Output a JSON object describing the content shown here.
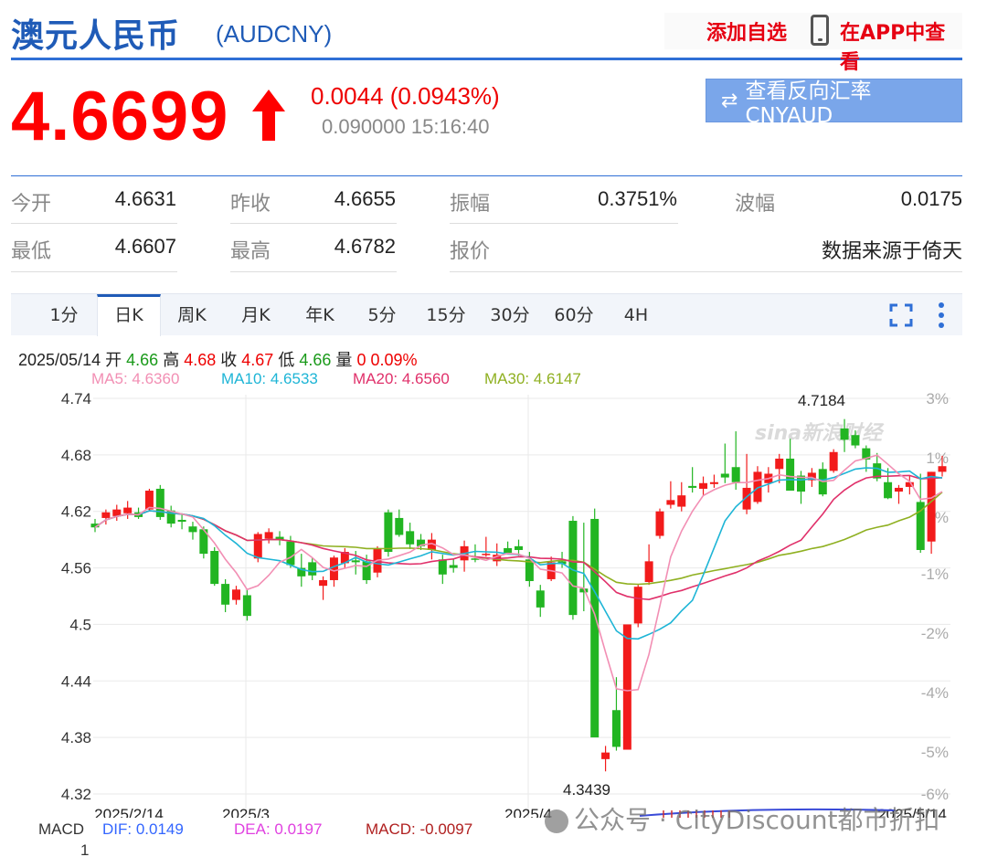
{
  "header": {
    "name": "澳元人民币",
    "code": "(AUDCNY)",
    "add_fav": "添加自选",
    "in_app": "在APP中查看"
  },
  "quote": {
    "price": "4.6699",
    "change": "0.0044 (0.0943%)",
    "sub": "0.090000 15:16:40",
    "reverse_btn": "查看反向汇率 CNYAUD",
    "up_color": "#ff0000"
  },
  "stats": {
    "open_label": "今开",
    "open": "4.6631",
    "prev_label": "昨收",
    "prev": "4.6655",
    "amp_label": "振幅",
    "amp": "0.3751%",
    "wave_label": "波幅",
    "wave": "0.0175",
    "low_label": "最低",
    "low": "4.6607",
    "high_label": "最高",
    "high": "4.6782",
    "quote_label": "报价",
    "source": "数据来源于倚天"
  },
  "tabs": [
    "1分",
    "日K",
    "周K",
    "月K",
    "年K",
    "5分",
    "15分",
    "30分",
    "60分",
    "4H"
  ],
  "active_tab": "日K",
  "ohlc": {
    "date": "2025/05/14",
    "open_label": "开",
    "open": "4.66",
    "high_label": "高",
    "high": "4.68",
    "close_label": "收",
    "close": "4.67",
    "low_label": "低",
    "low": "4.66",
    "vol_label": "量",
    "vol": "0",
    "pct": "0.09%"
  },
  "ma": {
    "ma5": "MA5: 4.6360",
    "ma10": "MA10: 4.6533",
    "ma20": "MA20: 4.6560",
    "ma30": "MA30: 4.6147",
    "ma5_color": "#f28fb4",
    "ma10_color": "#1eb5d6",
    "ma20_color": "#e0306a",
    "ma30_color": "#8fb021"
  },
  "macd": {
    "label": "MACD",
    "dif": "DIF: 0.0149",
    "dea": "DEA: 0.0197",
    "macd": "MACD: -0.0097",
    "axis_top": "1"
  },
  "watermark": "公众号 · CityDiscount都市折扣",
  "sina_watermark": "sina新浪财经",
  "chart_data": {
    "type": "candlestick",
    "y_ticks": [
      "4.74",
      "4.68",
      "4.62",
      "4.56",
      "4.5",
      "4.44",
      "4.38",
      "4.32"
    ],
    "pct_ticks": [
      "3%",
      "1%",
      "-1%",
      "-2%",
      "-4%",
      "-5%",
      "-6%"
    ],
    "pct_extra": "%",
    "x_labels": [
      "2025/2/14",
      "2025/3",
      "2025/4",
      "2025/5/14"
    ],
    "annotations": {
      "max": "4.7184",
      "min": "4.3439"
    },
    "ylim": [
      4.32,
      4.74
    ],
    "candles": [
      [
        4.607,
        4.612,
        4.598,
        4.603
      ],
      [
        4.613,
        4.622,
        4.606,
        4.619
      ],
      [
        4.615,
        4.627,
        4.61,
        4.622
      ],
      [
        4.618,
        4.631,
        4.612,
        4.624
      ],
      [
        4.619,
        4.624,
        4.612,
        4.614
      ],
      [
        4.622,
        4.644,
        4.62,
        4.642
      ],
      [
        4.644,
        4.648,
        4.611,
        4.614
      ],
      [
        4.621,
        4.626,
        4.603,
        4.607
      ],
      [
        4.611,
        4.618,
        4.601,
        4.609
      ],
      [
        4.604,
        4.609,
        4.59,
        4.598
      ],
      [
        4.601,
        4.604,
        4.57,
        4.575
      ],
      [
        4.578,
        4.582,
        4.541,
        4.543
      ],
      [
        4.543,
        4.548,
        4.513,
        4.521
      ],
      [
        4.526,
        4.541,
        4.521,
        4.537
      ],
      [
        4.531,
        4.537,
        4.504,
        4.509
      ],
      [
        4.57,
        4.598,
        4.566,
        4.596
      ],
      [
        4.591,
        4.602,
        4.586,
        4.598
      ],
      [
        4.593,
        4.599,
        4.584,
        4.59
      ],
      [
        4.588,
        4.594,
        4.56,
        4.563
      ],
      [
        4.56,
        4.575,
        4.54,
        4.551
      ],
      [
        4.566,
        4.571,
        4.547,
        4.552
      ],
      [
        4.541,
        4.551,
        4.526,
        4.547
      ],
      [
        4.547,
        4.573,
        4.54,
        4.571
      ],
      [
        4.565,
        4.581,
        4.56,
        4.577
      ],
      [
        4.568,
        4.578,
        4.553,
        4.566
      ],
      [
        4.567,
        4.574,
        4.543,
        4.547
      ],
      [
        4.555,
        4.583,
        4.55,
        4.58
      ],
      [
        4.619,
        4.622,
        4.572,
        4.577
      ],
      [
        4.613,
        4.622,
        4.593,
        4.595
      ],
      [
        4.599,
        4.608,
        4.58,
        4.585
      ],
      [
        4.59,
        4.596,
        4.579,
        4.583
      ],
      [
        4.579,
        4.597,
        4.569,
        4.59
      ],
      [
        4.569,
        4.574,
        4.543,
        4.553
      ],
      [
        4.563,
        4.57,
        4.555,
        4.56
      ],
      [
        4.568,
        4.589,
        4.556,
        4.583
      ],
      [
        4.57,
        4.585,
        4.566,
        4.569
      ],
      [
        4.574,
        4.593,
        4.572,
        4.575
      ],
      [
        4.567,
        4.586,
        4.562,
        4.574
      ],
      [
        4.581,
        4.588,
        4.575,
        4.576
      ],
      [
        4.583,
        4.59,
        4.573,
        4.579
      ],
      [
        4.569,
        4.577,
        4.54,
        4.546
      ],
      [
        4.536,
        4.542,
        4.508,
        4.518
      ],
      [
        4.548,
        4.572,
        4.546,
        4.566
      ],
      [
        4.567,
        4.577,
        4.56,
        4.564
      ],
      [
        4.61,
        4.615,
        4.505,
        4.51
      ],
      [
        4.538,
        4.608,
        4.514,
        4.534
      ],
      [
        4.612,
        4.623,
        4.387,
        4.38
      ],
      [
        4.357,
        4.371,
        4.344,
        4.364
      ],
      [
        4.409,
        4.444,
        4.366,
        4.37
      ],
      [
        4.367,
        4.37,
        4.368,
        4.5
      ],
      [
        4.501,
        4.542,
        4.497,
        4.54
      ],
      [
        4.545,
        4.585,
        4.542,
        4.567
      ],
      [
        4.594,
        4.623,
        4.591,
        4.62
      ],
      [
        4.627,
        4.652,
        4.623,
        4.632
      ],
      [
        4.625,
        4.651,
        4.62,
        4.637
      ],
      [
        4.647,
        4.667,
        4.64,
        4.645
      ],
      [
        4.644,
        4.657,
        4.637,
        4.65
      ],
      [
        4.649,
        4.659,
        4.645,
        4.651
      ],
      [
        4.66,
        4.692,
        4.65,
        4.656
      ],
      [
        4.667,
        4.705,
        4.643,
        4.651
      ],
      [
        4.622,
        4.681,
        4.617,
        4.645
      ],
      [
        4.63,
        4.668,
        4.628,
        4.662
      ],
      [
        4.65,
        4.667,
        4.64,
        4.66
      ],
      [
        4.665,
        4.681,
        4.65,
        4.676
      ],
      [
        4.676,
        4.697,
        4.667,
        4.642
      ],
      [
        4.658,
        4.663,
        4.628,
        4.641
      ],
      [
        4.653,
        4.666,
        4.646,
        4.661
      ],
      [
        4.665,
        4.672,
        4.636,
        4.638
      ],
      [
        4.663,
        4.686,
        4.661,
        4.683
      ],
      [
        4.708,
        4.718,
        4.683,
        4.696
      ],
      [
        4.701,
        4.706,
        4.687,
        4.69
      ],
      [
        4.687,
        4.69,
        4.662,
        4.675
      ],
      [
        4.671,
        4.682,
        4.652,
        4.655
      ],
      [
        4.651,
        4.666,
        4.633,
        4.634
      ],
      [
        4.641,
        4.648,
        4.628,
        4.645
      ],
      [
        4.646,
        4.658,
        4.638,
        4.651
      ],
      [
        4.63,
        4.66,
        4.576,
        4.579
      ],
      [
        4.588,
        4.662,
        4.575,
        4.662
      ],
      [
        4.662,
        4.679,
        4.657,
        4.668
      ]
    ]
  }
}
